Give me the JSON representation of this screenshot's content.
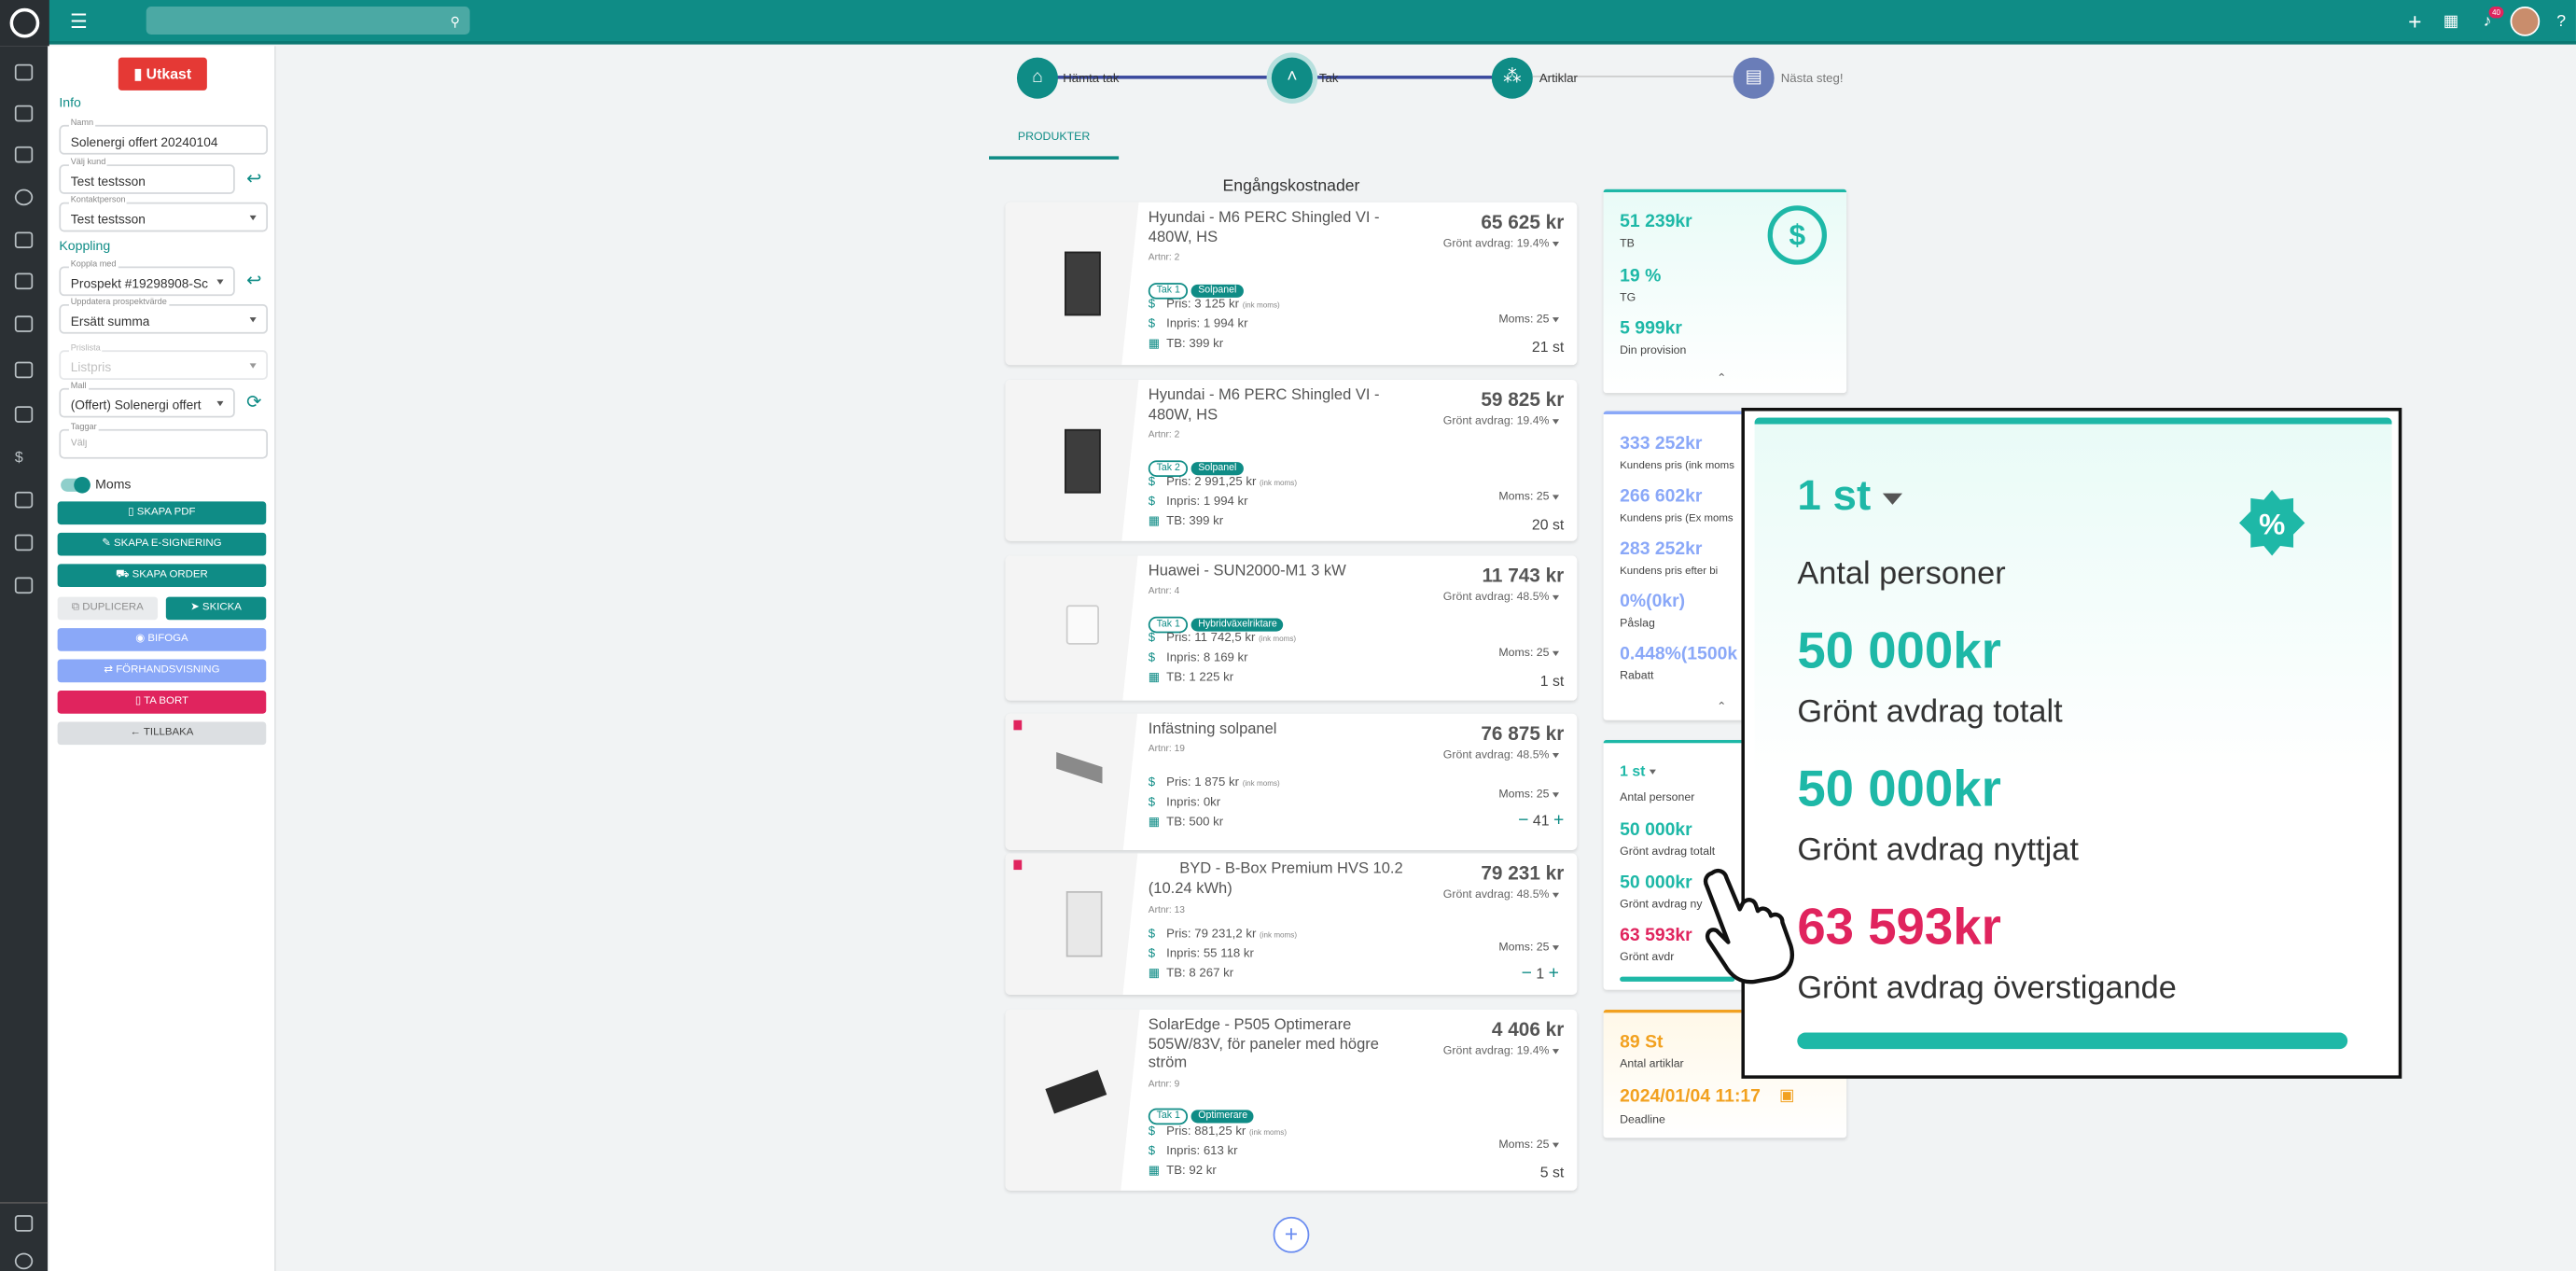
{
  "header": {
    "notification_count": "40"
  },
  "form": {
    "status_button": "Utkast",
    "info_label": "Info",
    "name_label": "Namn",
    "name_value": "Solenergi offert 20240104",
    "customer_label": "Välj kund",
    "customer_value": "Test testsson",
    "contact_label": "Kontaktperson",
    "contact_value": "Test testsson",
    "link_label": "Koppling",
    "link_with_label": "Koppla med",
    "link_with_value": "Prospekt #19298908-Sc",
    "update_label": "Uppdatera prospektvärde",
    "update_value": "Ersätt summa",
    "pricelist_label": "Prislista",
    "pricelist_value": "Listpris",
    "template_label": "Mall",
    "template_value": "(Offert) Solenergi offert",
    "tags_label": "Taggar",
    "tags_placeholder": "Välj",
    "vat_label": "Moms",
    "buttons": {
      "pdf": "Skapa PDF",
      "esign": "Skapa E-signering",
      "order": "Skapa order",
      "duplicate": "Duplicera",
      "send": "Skicka",
      "attach": "Bifoga",
      "preview": "Förhandsvisning",
      "delete": "Ta bort",
      "back": "Tillbaka"
    }
  },
  "steps": [
    {
      "label": "Hämta tak",
      "icon": "home-icon"
    },
    {
      "label": "Tak",
      "icon": "chevron-up-icon"
    },
    {
      "label": "Artiklar",
      "icon": "cubes-icon"
    },
    {
      "label": "Nästa steg!",
      "icon": "document-icon"
    }
  ],
  "tabs": {
    "products": "PRODUKTER"
  },
  "section_title": "Engångskostnader",
  "labels": {
    "price": "Pris:",
    "inprice": "Inpris:",
    "tb": "TB:",
    "incl_vat": "(ink moms)",
    "vat": "Moms: 25"
  },
  "products": [
    {
      "name": "Hyundai - M6 PERC Shingled VI - 480W, HS",
      "price": "65 625 kr",
      "green": "Grönt avdrag: 19.4%",
      "artnr": "Artnr: 2",
      "tags": [
        "Tak 1",
        "Solpanel"
      ],
      "pris": "3 125 kr",
      "inpris": "1 994 kr",
      "tb": "399 kr",
      "qty": "21 st"
    },
    {
      "name": "Hyundai - M6 PERC Shingled VI - 480W, HS",
      "price": "59 825 kr",
      "green": "Grönt avdrag: 19.4%",
      "artnr": "Artnr: 2",
      "tags": [
        "Tak 2",
        "Solpanel"
      ],
      "pris": "2 991,25 kr",
      "inpris": "1 994 kr",
      "tb": "399 kr",
      "qty": "20 st"
    },
    {
      "name": "Huawei - SUN2000-M1 3 kW",
      "price": "11 743 kr",
      "green": "Grönt avdrag: 48.5%",
      "artnr": "Artnr: 4",
      "tags": [
        "Tak 1",
        "Hybridväxelriktare"
      ],
      "pris": "11 742,5 kr",
      "inpris": "8 169 kr",
      "tb": "1 225 kr",
      "qty": "1 st"
    },
    {
      "name": "Infästning solpanel",
      "price": "76 875 kr",
      "green": "Grönt avdrag: 48.5%",
      "artnr": "Artnr: 19",
      "tags": [],
      "pris": "1 875 kr",
      "inpris": "0kr",
      "tb": "500 kr",
      "qty": "41"
    },
    {
      "name": "BYD - B-Box Premium HVS 10.2 (10.24 kWh)",
      "price": "79 231 kr",
      "green": "Grönt avdrag: 48.5%",
      "artnr": "Artnr: 13",
      "tags": [],
      "pris": "79 231,2 kr",
      "inpris": "55 118 kr",
      "tb": "8 267 kr",
      "qty": "1"
    },
    {
      "name": "SolarEdge - P505 Optimerare 505W/83V, för paneler med högre ström",
      "price": "4 406 kr",
      "green": "Grönt avdrag: 19.4%",
      "artnr": "Artnr: 9",
      "tags": [
        "Tak 1",
        "Optimerare"
      ],
      "pris": "881,25 kr",
      "inpris": "613 kr",
      "tb": "92 kr",
      "qty": "5 st"
    }
  ],
  "summary": {
    "tb_value": "51 239kr",
    "tb_label": "TB",
    "tg_value": "19 %",
    "tg_label": "TG",
    "prov_value": "5 999kr",
    "prov_label": "Din provision",
    "cust_price": "333 252kr",
    "cust_price_label": "Kundens pris (ink moms",
    "cust_price_ex": "266 602kr",
    "cust_price_ex_label": "Kundens pris (Ex moms",
    "cust_price_after": "283 252kr",
    "cust_price_after_label": "Kundens pris efter bi",
    "markup": "0%(0kr)",
    "markup_label": "Påslag",
    "discount": "0.448%(1500k",
    "discount_label": "Rabatt",
    "persons": "1 st",
    "persons_label": "Antal personer",
    "green_total": "50 000kr",
    "green_total_label": "Grönt avdrag totalt",
    "green_used": "50 000kr",
    "green_used_label": "Grönt avdrag ny",
    "green_over": "63 593kr",
    "green_over_label": "Grönt avdr",
    "articles": "89 St",
    "articles_label": "Antal artiklar",
    "deadline": "2024/01/04 11:17",
    "deadline_label": "Deadline"
  },
  "zoom": {
    "persons": "1 st",
    "persons_label": "Antal personer",
    "green_total": "50 000kr",
    "green_total_label": "Grönt avdrag totalt",
    "green_used": "50 000kr",
    "green_used_label": "Grönt avdrag nyttjat",
    "green_over": "63 593kr",
    "green_over_label": "Grönt avdrag överstigande",
    "progress_fraction": 1.0
  },
  "colors": {
    "brand": "#0f8c86",
    "accent_teal": "#1eb8a7",
    "blue": "#8aa8f8",
    "pink": "#e0245e",
    "orange": "#f2a120"
  }
}
